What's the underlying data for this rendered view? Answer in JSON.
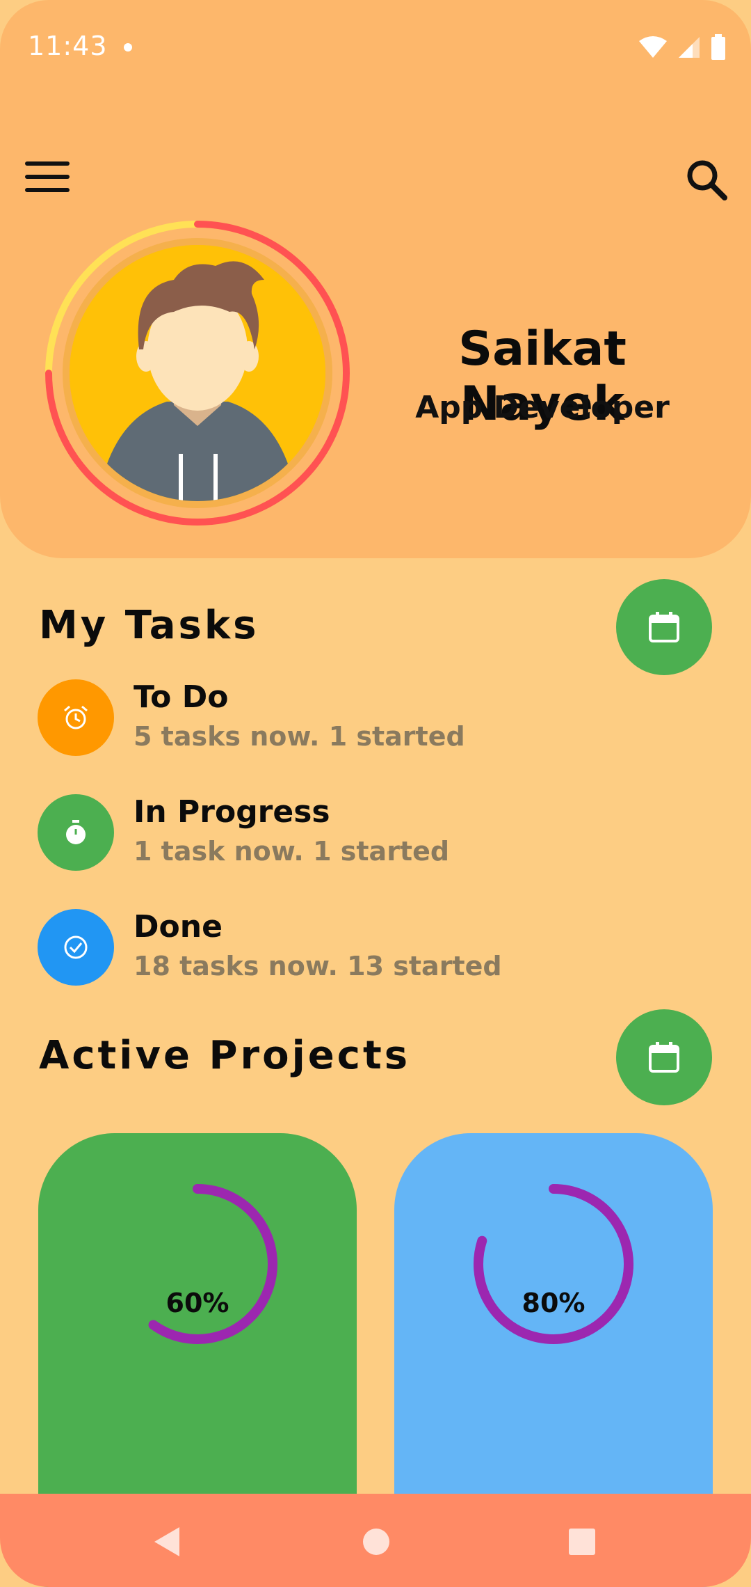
{
  "status_bar": {
    "time": "11:43"
  },
  "profile": {
    "name": "Saikat Nayek",
    "role": "App Developer"
  },
  "my_tasks": {
    "title": "My Tasks",
    "items": [
      {
        "label": "To Do",
        "subtitle": "5 tasks now. 1 started",
        "icon": "alarm-icon",
        "color": "#FF9800"
      },
      {
        "label": "In Progress",
        "subtitle": "1 task now. 1 started",
        "icon": "timer-icon",
        "color": "#4CAF50"
      },
      {
        "label": "Done",
        "subtitle": "18 tasks now. 13 started",
        "icon": "check-circle-icon",
        "color": "#2196F3"
      }
    ]
  },
  "active_projects": {
    "title": "Active Projects",
    "cards": [
      {
        "percent_label": "60%",
        "progress": 0.6,
        "color": "#4CAF50"
      },
      {
        "percent_label": "80%",
        "progress": 0.8,
        "color": "#64B5F6"
      }
    ]
  },
  "colors": {
    "header_bg": "#FDB76B",
    "page_bg": "#FDCD83",
    "nav_bg": "#FF8A65",
    "ring_red": "#FF5252",
    "ring_yellow": "#FFE156",
    "progress_purple": "#9C27B0"
  }
}
